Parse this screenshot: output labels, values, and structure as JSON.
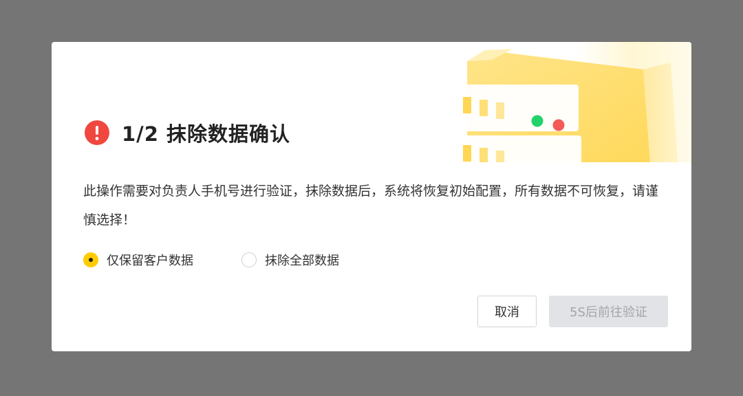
{
  "dialog": {
    "title": "1/2 抹除数据确认",
    "description": "此操作需要对负责人手机号进行验证，抹除数据后，系统将恢复初始配置，所有数据不可恢复，请谨慎选择！",
    "options": [
      {
        "label": "仅保留客户数据",
        "checked": true
      },
      {
        "label": "抹除全部数据",
        "checked": false
      }
    ],
    "buttons": {
      "cancel": "取消",
      "confirm": "5S后前往验证",
      "confirm_disabled": true
    },
    "icons": {
      "title_icon": "warning-icon",
      "illustration": "server-illustration"
    }
  },
  "colors": {
    "backdrop": "#757575",
    "warning": "#f0483e",
    "accent": "#ffcc00",
    "disabled_button_bg": "#e2e3e6",
    "disabled_button_text": "#a2a4a8"
  }
}
